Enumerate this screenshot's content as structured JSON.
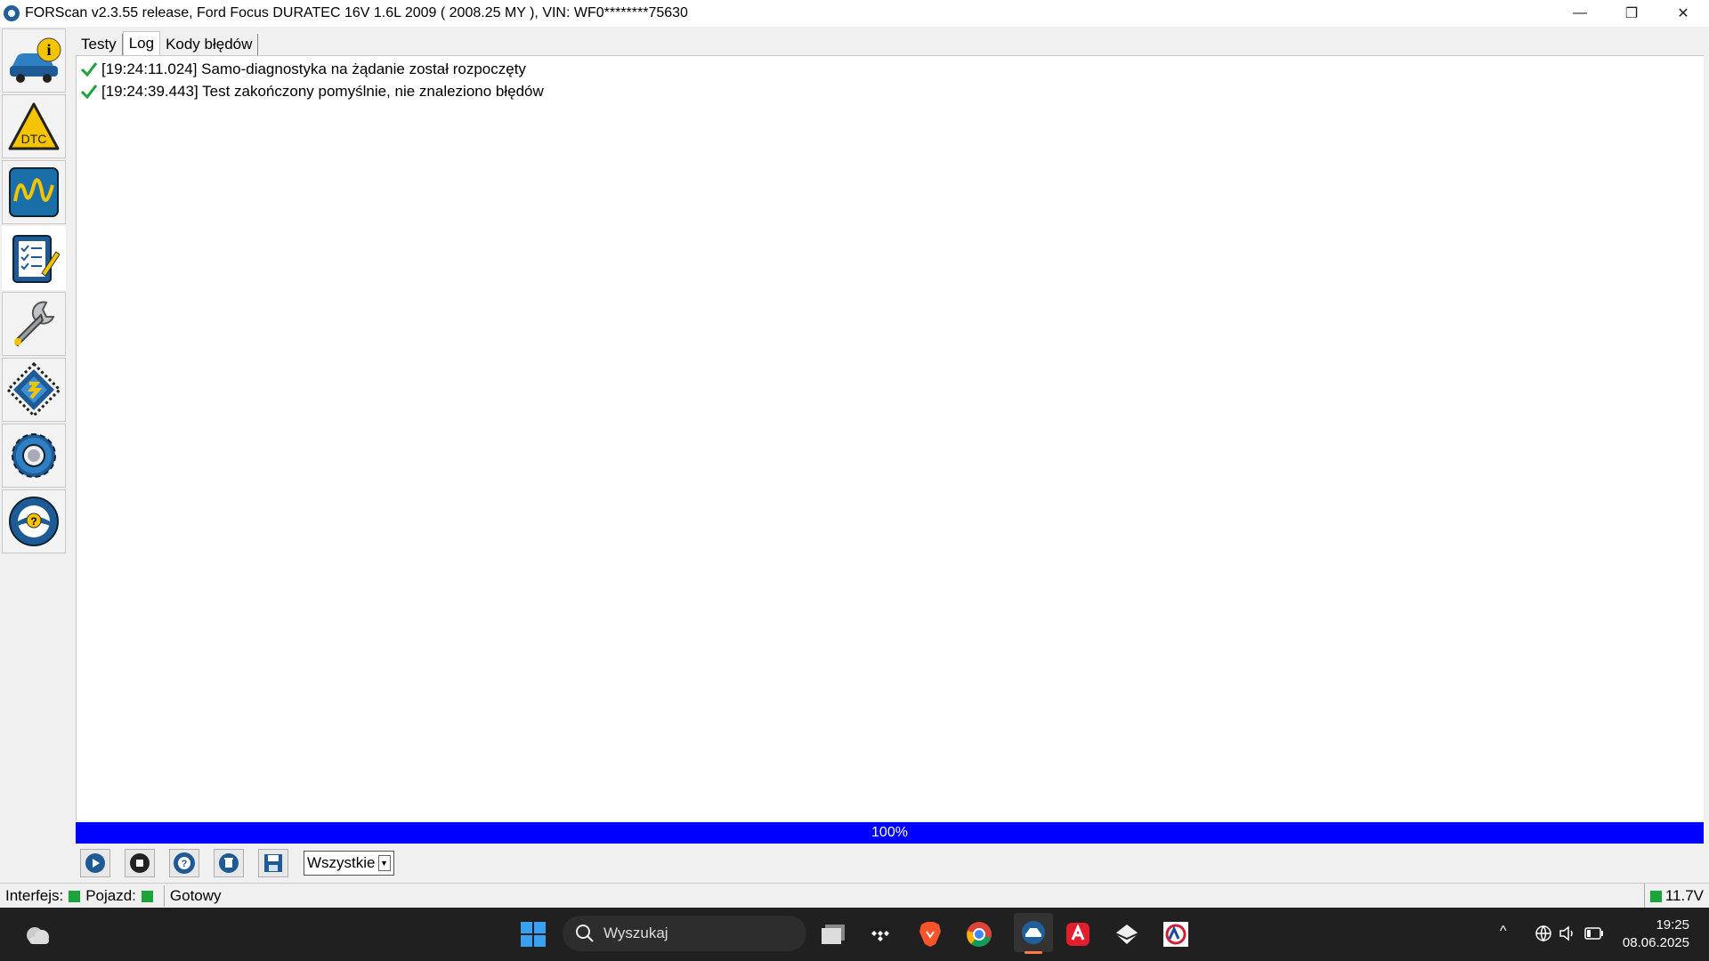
{
  "window": {
    "title": "FORScan v2.3.55 release, Ford Focus DURATEC 16V 1.6L 2009 ( 2008.25 MY ), VIN: WF0********75630",
    "minimize": "—",
    "maximize": "❐",
    "close": "✕"
  },
  "sidebar": {
    "items": [
      {
        "name": "vehicle-info",
        "icon": "car-info-icon",
        "active": false
      },
      {
        "name": "dtc",
        "icon": "dtc-warning-icon",
        "active": false
      },
      {
        "name": "oscilloscope",
        "icon": "waveform-icon",
        "active": false
      },
      {
        "name": "tests",
        "icon": "checklist-icon",
        "active": true
      },
      {
        "name": "service",
        "icon": "wrench-icon",
        "active": false
      },
      {
        "name": "configuration",
        "icon": "chip-icon",
        "active": false
      },
      {
        "name": "settings",
        "icon": "gear-icon",
        "active": false
      },
      {
        "name": "help",
        "icon": "help-wheel-icon",
        "active": false
      }
    ]
  },
  "tabs": [
    {
      "label": "Testy",
      "active": false
    },
    {
      "label": "Log",
      "active": true
    },
    {
      "label": "Kody błędów",
      "active": false
    }
  ],
  "log": [
    {
      "text": "[19:24:11.024] Samo-diagnostyka na żądanie został rozpoczęty",
      "status": "ok"
    },
    {
      "text": "[19:24:39.443] Test zakończony pomyślnie, nie znaleziono błędów",
      "status": "ok"
    }
  ],
  "progress": {
    "label": "100%",
    "value": 100
  },
  "toolbar": {
    "buttons": [
      "play-icon",
      "stop-icon",
      "help-lifebuoy-icon",
      "clear-log-icon",
      "save-icon"
    ],
    "filter_value": "Wszystkie"
  },
  "status": {
    "interface_label": "Interfejs:",
    "vehicle_label": "Pojazd:",
    "state": "Gotowy",
    "voltage": "11.7V",
    "indicator_color": "#1aa43a"
  },
  "taskbar": {
    "search_placeholder": "Wyszukaj",
    "time": "19:25",
    "date": "08.06.2025"
  }
}
